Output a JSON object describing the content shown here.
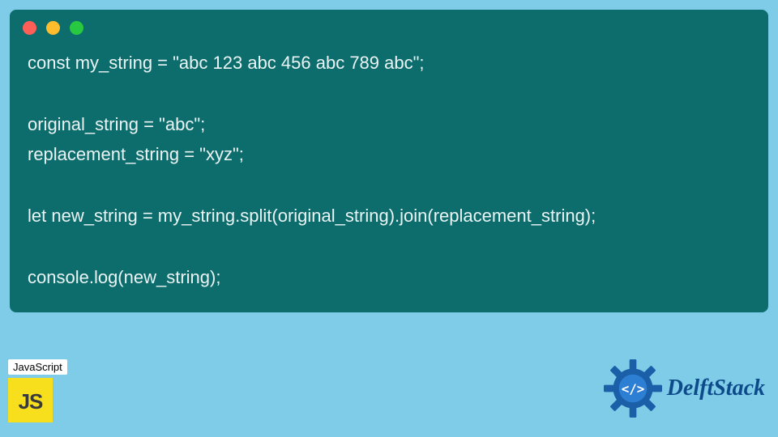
{
  "code": {
    "lines": [
      "const my_string = \"abc 123 abc 456 abc 789 abc\";",
      "",
      "original_string = \"abc\";",
      "replacement_string = \"xyz\";",
      "",
      "let new_string = my_string.split(original_string).join(replacement_string);",
      "",
      "console.log(new_string);"
    ]
  },
  "badge": {
    "label": "JavaScript",
    "logo_text": "JS"
  },
  "brand": {
    "name": "DelftStack"
  },
  "colors": {
    "page_bg": "#7ecce8",
    "window_bg": "#0d6d6d",
    "code_text": "#eaf4f4",
    "js_yellow": "#f7df1e",
    "brand_blue": "#0d4a8a"
  }
}
